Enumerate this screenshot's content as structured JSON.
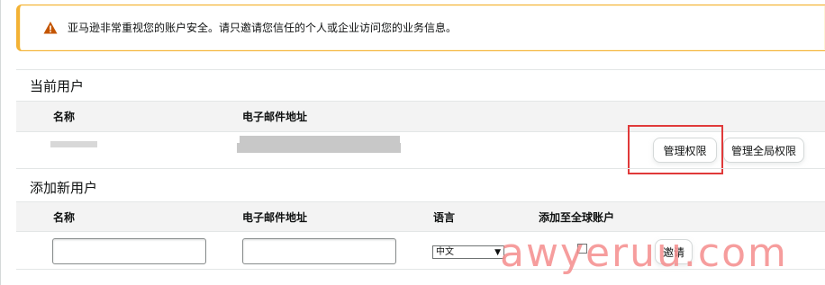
{
  "alert": {
    "icon": "warning-icon",
    "accent_color": "#f3b235",
    "text": "亚马逊非常重视您的账户安全。请只邀请您信任的个人或企业访问您的业务信息。"
  },
  "current_users": {
    "title": "当前用户",
    "columns": {
      "name": "名称",
      "email": "电子邮件地址"
    },
    "buttons": {
      "manage_permissions": "管理权限",
      "manage_global_permissions": "管理全局权限"
    }
  },
  "add_user": {
    "title": "添加新用户",
    "columns": {
      "name": "名称",
      "email": "电子邮件地址",
      "language": "语言",
      "add_global": "添加至全球账户"
    },
    "language_selected": "中文",
    "invite_button": "邀请"
  },
  "watermark": "awyeruu.com",
  "highlight_color": "#e03a3a"
}
